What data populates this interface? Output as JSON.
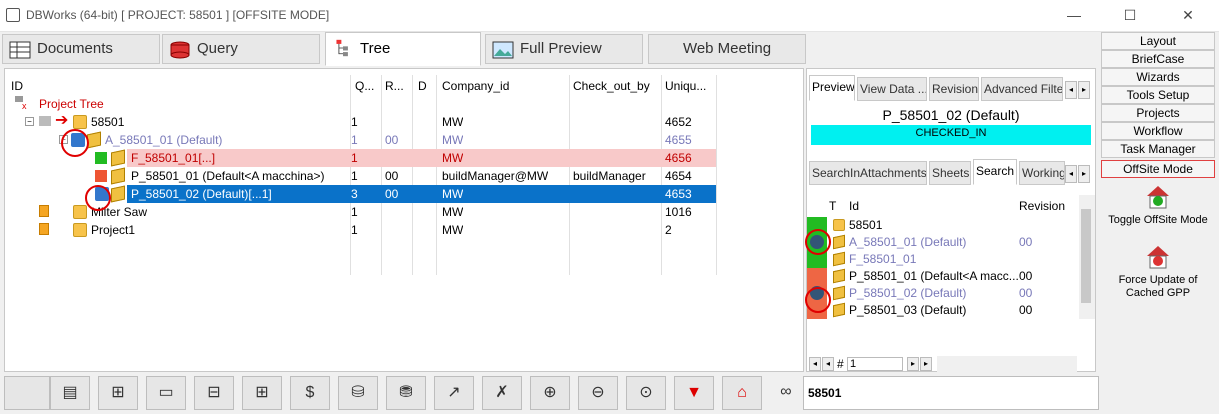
{
  "window": {
    "title": "DBWorks (64-bit) [ PROJECT: 58501 ] [OFFSITE MODE]"
  },
  "tabs": [
    {
      "label": "Documents",
      "icon": "table-icon"
    },
    {
      "label": "Query",
      "icon": "database-icon"
    },
    {
      "label": "Tree",
      "icon": "tree-icon",
      "active": true
    },
    {
      "label": "Full Preview",
      "icon": "image-icon"
    },
    {
      "label": "Web Meeting",
      "icon": ""
    }
  ],
  "grid": {
    "headers": [
      "ID",
      "Q...",
      "R...",
      "D",
      "Company_id",
      "Check_out_by",
      "Uniqu..."
    ],
    "root_label": "Project Tree",
    "rows": [
      {
        "name": "58501",
        "q": "1",
        "r": "",
        "company": "MW",
        "check": "",
        "uniq": "4652"
      },
      {
        "name": "A_58501_01 (Default)",
        "q": "1",
        "r": "00",
        "company": "MW",
        "check": "",
        "uniq": "4655"
      },
      {
        "name": "F_58501_01[...]",
        "q": "1",
        "r": "",
        "company": "MW",
        "check": "",
        "uniq": "4656"
      },
      {
        "name": "P_58501_01 (Default<A macchina>)",
        "q": "1",
        "r": "00",
        "company": "buildManager@MW",
        "check": "buildManager",
        "uniq": "4654"
      },
      {
        "name": "P_58501_02 (Default)[...1]",
        "q": "3",
        "r": "00",
        "company": "MW",
        "check": "",
        "uniq": "4653"
      },
      {
        "name": "Milter Saw",
        "q": "1",
        "r": "",
        "company": "MW",
        "check": "",
        "uniq": "1016"
      },
      {
        "name": "Project1",
        "q": "1",
        "r": "",
        "company": "MW",
        "check": "",
        "uniq": "2"
      }
    ]
  },
  "toolbar": {
    "buttons": [
      "table-icon",
      "add-doc-icon",
      "folder-icon",
      "tree-expand-icon",
      "tree-collapse-icon",
      "doc-dollar-icon",
      "db-export-icon",
      "db-stack-icon",
      "sort-icon",
      "doc-cancel-icon",
      "zoom-in-icon",
      "zoom-out-icon",
      "zoom-fit-icon",
      "filter-icon",
      "home-icon"
    ],
    "glasses_icon": "glasses-icon",
    "search_value": "58501"
  },
  "right": {
    "top_tabs": [
      "Preview",
      "View Data ...",
      "Revision",
      "Advanced Filter"
    ],
    "preview_title": "P_58501_02 (Default)",
    "status": "CHECKED_IN",
    "bottom_tabs": [
      "SearchInAttachments",
      "Sheets",
      "Search",
      "Working"
    ],
    "search_headers": [
      "T",
      "Id",
      "Revision"
    ],
    "search_rows": [
      {
        "id": "58501",
        "rev": ""
      },
      {
        "id": "A_58501_01 (Default)",
        "rev": "00"
      },
      {
        "id": "F_58501_01",
        "rev": ""
      },
      {
        "id": "P_58501_01 (Default<A macc...",
        "rev": "00"
      },
      {
        "id": "P_58501_02 (Default)",
        "rev": "00"
      },
      {
        "id": "P_58501_03 (Default)",
        "rev": "00"
      }
    ],
    "pager": {
      "hash": "#",
      "page": "1"
    }
  },
  "side": {
    "buttons": [
      "Layout",
      "BriefCase",
      "Wizards",
      "Tools Setup",
      "Projects",
      "Workflow",
      "Task Manager",
      "OffSite Mode"
    ],
    "toggle_label": "Toggle OffSite Mode",
    "force_label": "Force Update of Cached GPP"
  },
  "window_controls": {
    "min": "—",
    "max": "☐",
    "close": "✕"
  }
}
